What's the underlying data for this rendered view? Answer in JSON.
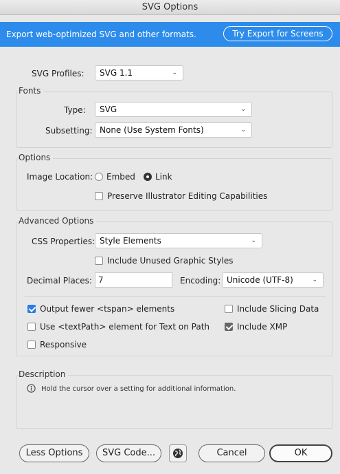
{
  "window": {
    "title": "SVG Options"
  },
  "banner": {
    "message": "Export web-optimized SVG and other formats.",
    "try_button": "Try Export for Screens"
  },
  "svg_profiles": {
    "label": "SVG Profiles:",
    "value": "SVG 1.1"
  },
  "fonts": {
    "title": "Fonts",
    "type_label": "Type:",
    "type_value": "SVG",
    "subsetting_label": "Subsetting:",
    "subsetting_value": "None (Use System Fonts)"
  },
  "options": {
    "title": "Options",
    "image_location_label": "Image Location:",
    "embed_label": "Embed",
    "link_label": "Link",
    "selected": "Link",
    "preserve_label": "Preserve Illustrator Editing Capabilities",
    "preserve_checked": false
  },
  "advanced": {
    "title": "Advanced Options",
    "css_label": "CSS Properties:",
    "css_value": "Style Elements",
    "unused_styles_label": "Include Unused Graphic Styles",
    "unused_styles_checked": false,
    "decimal_label": "Decimal Places:",
    "decimal_value": "7",
    "encoding_label": "Encoding:",
    "encoding_value": "Unicode (UTF-8)",
    "tspan_label": "Output fewer <tspan> elements",
    "tspan_checked": true,
    "slicing_label": "Include Slicing Data",
    "slicing_checked": false,
    "textpath_label": "Use <textPath> element for Text on Path",
    "textpath_checked": false,
    "xmp_label": "Include XMP",
    "xmp_checked": true,
    "responsive_label": "Responsive",
    "responsive_checked": false
  },
  "description": {
    "title": "Description",
    "text": "Hold the cursor over a setting for additional information."
  },
  "footer": {
    "less_options": "Less Options",
    "svg_code": "SVG Code...",
    "cancel": "Cancel",
    "ok": "OK"
  },
  "colors": {
    "accent": "#2d8ceb",
    "checkbox_blue": "#2d7be5"
  },
  "icons": {
    "info": "info-icon",
    "globe": "globe-icon",
    "chevron": "chevron-down-icon"
  }
}
